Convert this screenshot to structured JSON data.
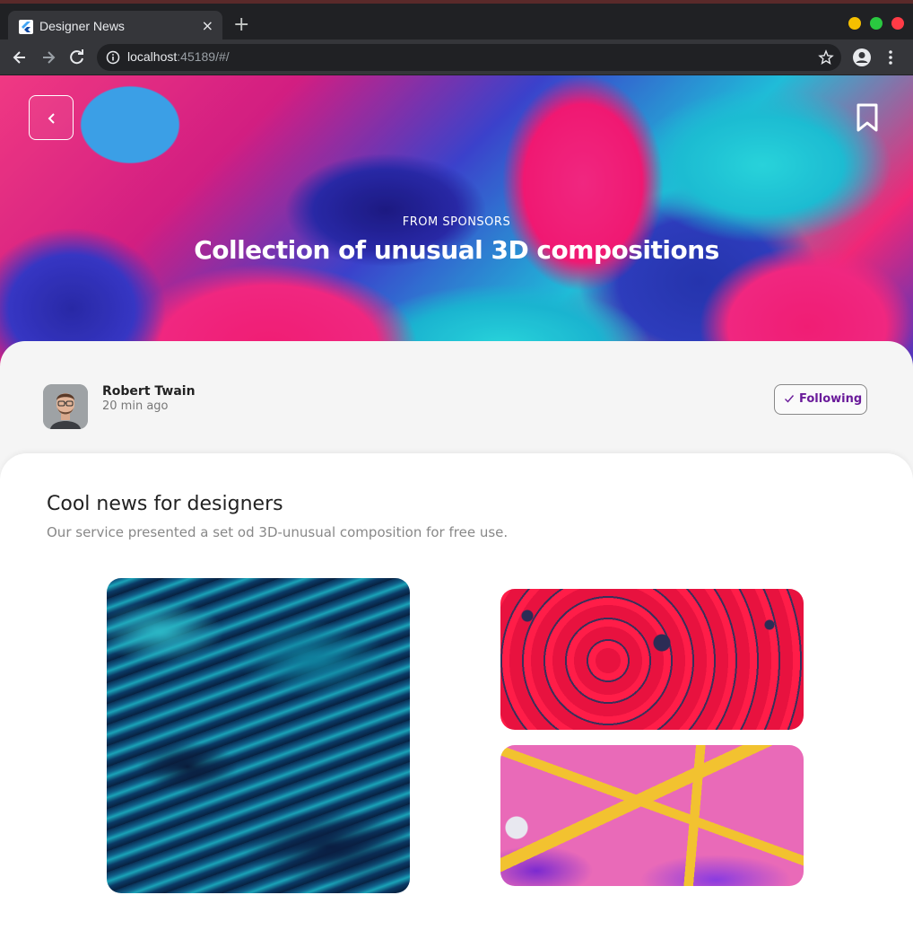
{
  "browser": {
    "tab_title": "Designer News",
    "tab_close": "×",
    "new_tab": "+",
    "url_host": "localhost",
    "url_rest": ":45189/#/",
    "window_dots": {
      "minimize": "#f5c000",
      "maximize": "#2ac840",
      "close": "#ff3b46"
    }
  },
  "hero": {
    "kicker": "FROM SPONSORS",
    "title": "Collection of unusual 3D compositions"
  },
  "author": {
    "name": "Robert Twain",
    "time": "20 min ago",
    "follow_label": "Following"
  },
  "content": {
    "title": "Cool news for designers",
    "description": "Our service presented a set od 3D-unusual composition for free use."
  },
  "icons": {
    "back": "chevron-left-icon",
    "bookmark": "bookmark-icon",
    "check": "check-icon"
  },
  "colors": {
    "accent_purple": "#6a1b9a",
    "card_bg": "#ffffff"
  }
}
